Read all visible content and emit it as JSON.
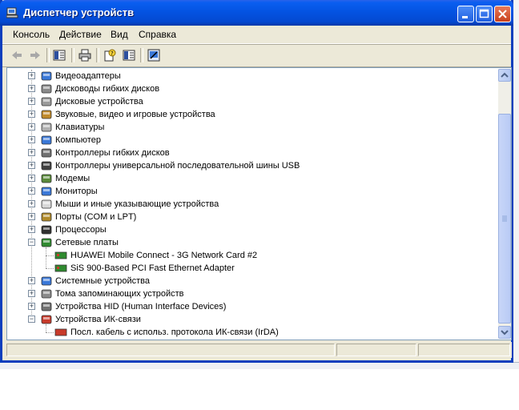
{
  "window": {
    "title": "Диспетчер устройств"
  },
  "menu": [
    "Консоль",
    "Действие",
    "Вид",
    "Справка"
  ],
  "toolbar": {
    "back_icon": "arrow-left-icon",
    "forward_icon": "arrow-right-icon",
    "tool_icons": [
      "console-tree-icon",
      "print-icon",
      "properties-icon",
      "scan-hardware-icon",
      "update-driver-icon"
    ]
  },
  "tree": [
    {
      "label": "Видеоадаптеры",
      "expanded": false,
      "icon": "display-adapter-icon"
    },
    {
      "label": "Дисководы гибких дисков",
      "expanded": false,
      "icon": "floppy-drive-icon"
    },
    {
      "label": "Дисковые устройства",
      "expanded": false,
      "icon": "disk-drive-icon"
    },
    {
      "label": "Звуковые, видео и игровые устройства",
      "expanded": false,
      "icon": "sound-icon"
    },
    {
      "label": "Клавиатуры",
      "expanded": false,
      "icon": "keyboard-icon"
    },
    {
      "label": "Компьютер",
      "expanded": false,
      "icon": "computer-icon"
    },
    {
      "label": "Контроллеры гибких дисков",
      "expanded": false,
      "icon": "floppy-controller-icon"
    },
    {
      "label": "Контроллеры универсальной последовательной шины USB",
      "expanded": false,
      "icon": "usb-icon"
    },
    {
      "label": "Модемы",
      "expanded": false,
      "icon": "modem-icon"
    },
    {
      "label": "Мониторы",
      "expanded": false,
      "icon": "monitor-icon"
    },
    {
      "label": "Мыши и иные указывающие устройства",
      "expanded": false,
      "icon": "mouse-icon"
    },
    {
      "label": "Порты (COM и LPT)",
      "expanded": false,
      "icon": "port-icon"
    },
    {
      "label": "Процессоры",
      "expanded": false,
      "icon": "processor-icon"
    },
    {
      "label": "Сетевые платы",
      "expanded": true,
      "icon": "network-card-icon",
      "children": [
        {
          "label": "HUAWEI Mobile Connect - 3G Network Card #2",
          "icon": "network-card-icon"
        },
        {
          "label": "SiS 900-Based PCI Fast Ethernet Adapter",
          "icon": "network-card-icon"
        }
      ]
    },
    {
      "label": "Системные устройства",
      "expanded": false,
      "icon": "system-device-icon"
    },
    {
      "label": "Тома запоминающих устройств",
      "expanded": false,
      "icon": "storage-volume-icon"
    },
    {
      "label": "Устройства HID (Human Interface Devices)",
      "expanded": false,
      "icon": "hid-icon"
    },
    {
      "label": "Устройства ИК-связи",
      "expanded": true,
      "icon": "infrared-icon",
      "children": [
        {
          "label": "Посл. кабель с использ. протокола ИК-связи (IrDA)",
          "icon": "infrared-icon"
        }
      ]
    }
  ],
  "expander": {
    "collapsed": "+",
    "expanded": "−"
  },
  "colors": {
    "titlebar": "#0453e2",
    "face": "#ece9d8",
    "border": "#0b3fbd"
  }
}
